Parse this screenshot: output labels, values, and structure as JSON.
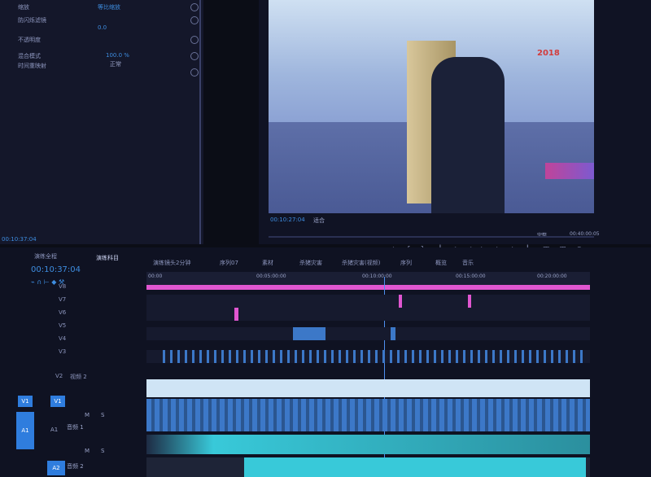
{
  "effect_controls": {
    "rows": [
      {
        "label": "缩放",
        "value": "等比缩放"
      },
      {
        "label": "防闪烁滤镜",
        "value": "0.0"
      },
      {
        "label": "不透明度",
        "value": ""
      },
      {
        "label": "混合模式",
        "value": "正常"
      },
      {
        "label": "时间重映射",
        "value": ""
      }
    ],
    "opacity_value": "100.0 %",
    "timecode": "00:10:37:04"
  },
  "program_monitor": {
    "timecode": "00:10:27:04",
    "fit_label": "适合",
    "quality": "完整",
    "duration": "00:40:00:05",
    "overlay_text": "2018"
  },
  "timeline": {
    "tabs": [
      "演练全程",
      "演练科目",
      "演练镜头2分钟",
      "序列07",
      "素材",
      "杀猪灾害",
      "杀猪灾害(视频)",
      "序列",
      "概览",
      "音乐"
    ],
    "active_tab_index": 1,
    "timecode": "00:10:37:04",
    "ruler": [
      "00:00",
      "00:05:00:00",
      "00:10:00:00",
      "00:15:00:00",
      "00:20:00:00"
    ],
    "video_tracks": [
      "V8",
      "V7",
      "V6",
      "V5",
      "V4",
      "V3",
      "V2"
    ],
    "v2_name": "视频 2",
    "v1_label": "V1",
    "audio_tracks": [
      {
        "id": "A1",
        "name": "音频 1"
      },
      {
        "id": "A2",
        "name": "音频 2"
      }
    ],
    "mute_label": "M",
    "solo_label": "S"
  },
  "colors": {
    "accent": "#2f7dde",
    "pink": "#e056d0",
    "cyan": "#38c9d9",
    "blue_clip": "#3c78c8"
  }
}
